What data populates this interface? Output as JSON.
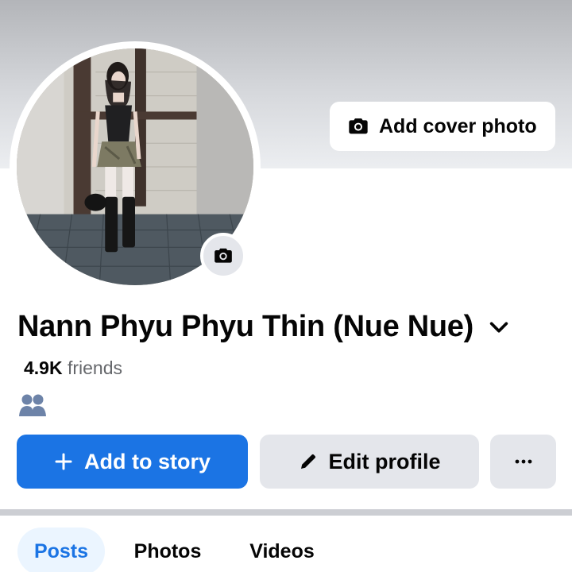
{
  "cover": {
    "add_cover_label": "Add cover photo",
    "icon": "camera-icon"
  },
  "profile": {
    "avatar_icon": "camera-icon",
    "name": "Nann Phyu Phyu Thin (Nue Nue)",
    "friends_count": "4.9K",
    "friends_label": "friends",
    "friend_icon": "friends-icon"
  },
  "actions": {
    "story_label": "Add to story",
    "edit_label": "Edit profile",
    "more_icon": "more-dots-icon"
  },
  "tabs": [
    {
      "label": "Posts",
      "active": true
    },
    {
      "label": "Photos",
      "active": false
    },
    {
      "label": "Videos",
      "active": false
    }
  ],
  "colors": {
    "primary": "#1b74e4",
    "button_gray": "#e4e6eb",
    "text": "#050505",
    "secondary_text": "#65676b",
    "active_tab_bg": "#ebf5ff"
  }
}
